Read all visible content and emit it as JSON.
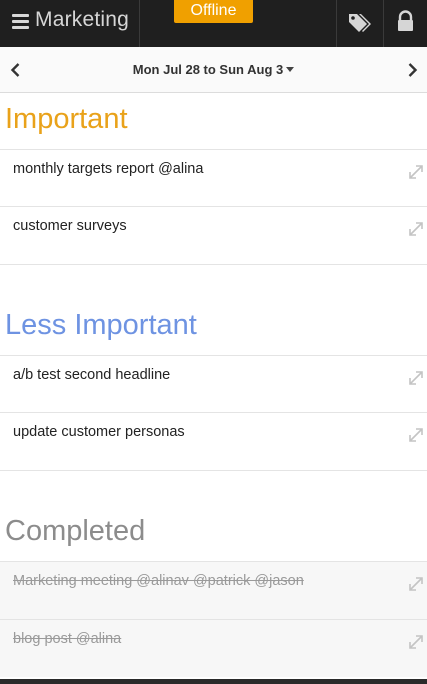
{
  "app": {
    "title": "Marketing",
    "offline_badge": "Offline"
  },
  "icons": {
    "menu": "hamburger-icon",
    "tags": "tag-icon",
    "lock": "lock-icon",
    "prev": "chevron-left-icon",
    "next": "chevron-right-icon",
    "expand": "expand-arrow-icon",
    "dropdown": "caret-down-icon"
  },
  "week_nav": {
    "range_label": "Mon Jul 28 to Sun Aug 3"
  },
  "colors": {
    "topbar": "#1f1f1f",
    "offline": "#f0a000",
    "important": "#e9a21a",
    "less_important": "#6e93e2",
    "completed": "#8c8c8c"
  },
  "sections": [
    {
      "title": "Important",
      "tasks": [
        {
          "text": "monthly targets report @alina",
          "completed": false
        },
        {
          "text": "customer surveys",
          "completed": false
        }
      ]
    },
    {
      "title": "Less Important",
      "tasks": [
        {
          "text": "a/b test second headline",
          "completed": false
        },
        {
          "text": "update customer personas",
          "completed": false
        }
      ]
    },
    {
      "title": "Completed",
      "tasks": [
        {
          "text": "Marketing meeting @alinav @patrick @jason",
          "completed": true
        },
        {
          "text": "blog post @alina",
          "completed": true
        }
      ]
    }
  ]
}
